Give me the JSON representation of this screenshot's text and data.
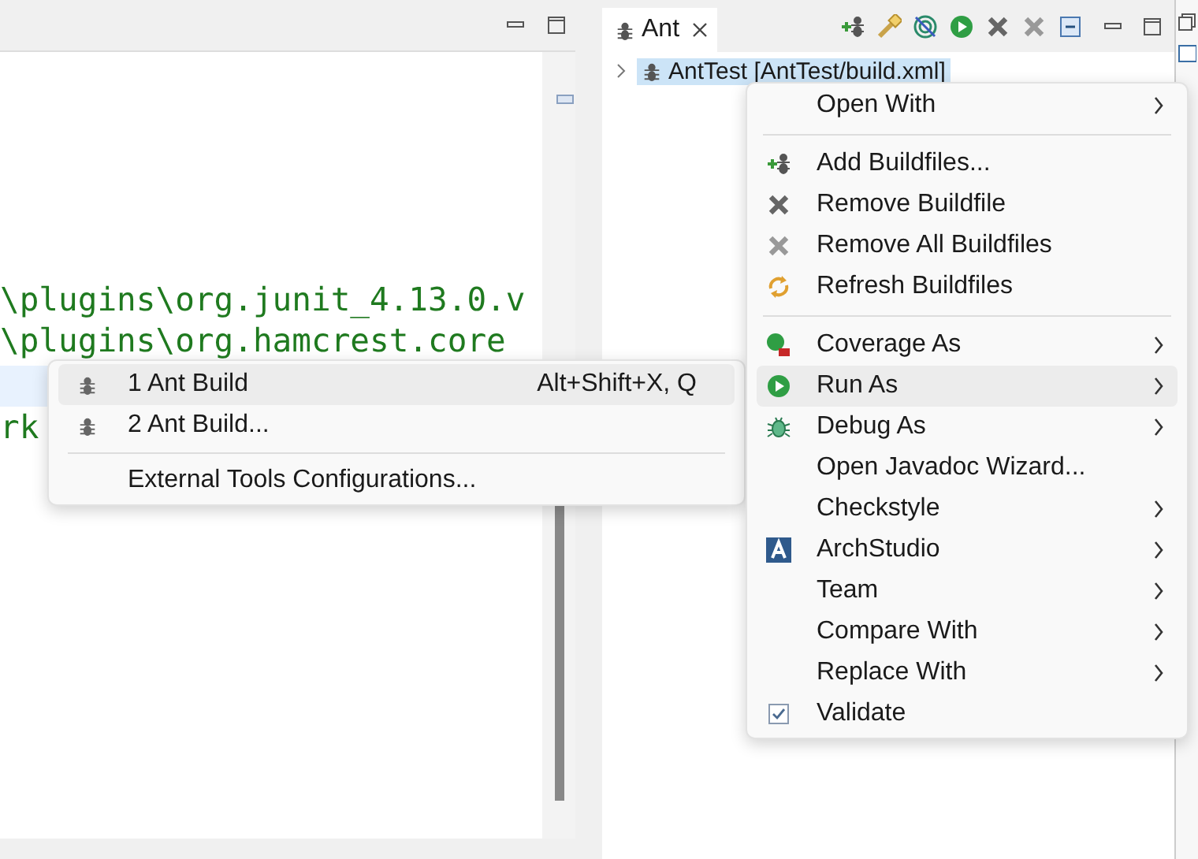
{
  "editor": {
    "code_lines": [
      {
        "text": "\\plugins\\org.junit_4.13.0.v",
        "current": false
      },
      {
        "text": "\\plugins\\org.hamcrest.core",
        "current": false
      },
      {
        "text": "rk",
        "current": false
      }
    ]
  },
  "ant_view": {
    "tab": {
      "label": "Ant",
      "selected": true
    },
    "tree": [
      {
        "label": "AntTest  [AntTest/build.xml]",
        "expanded": false,
        "selected": true
      }
    ]
  },
  "run_as_submenu": {
    "items": [
      {
        "kind": "item",
        "label": "1 Ant Build",
        "shortcut": "Alt+Shift+X, Q",
        "selected": true
      },
      {
        "kind": "item",
        "label": "2 Ant Build...",
        "selected": false
      },
      {
        "kind": "separator"
      },
      {
        "kind": "item",
        "label": "External Tools Configurations...",
        "selected": false
      }
    ]
  },
  "context_menu": {
    "items": [
      {
        "kind": "item",
        "label": "Open With",
        "submenu": true,
        "selected": false
      },
      {
        "kind": "separator"
      },
      {
        "kind": "item",
        "label": "Add Buildfiles...",
        "submenu": false,
        "selected": false
      },
      {
        "kind": "item",
        "label": "Remove Buildfile",
        "submenu": false,
        "selected": false
      },
      {
        "kind": "item",
        "label": "Remove All Buildfiles",
        "submenu": false,
        "selected": false
      },
      {
        "kind": "item",
        "label": "Refresh Buildfiles",
        "submenu": false,
        "selected": false
      },
      {
        "kind": "separator"
      },
      {
        "kind": "item",
        "label": "Coverage As",
        "submenu": true,
        "selected": false
      },
      {
        "kind": "item",
        "label": "Run As",
        "submenu": true,
        "selected": true
      },
      {
        "kind": "item",
        "label": "Debug As",
        "submenu": true,
        "selected": false
      },
      {
        "kind": "item",
        "label": "Open Javadoc Wizard...",
        "submenu": false,
        "selected": false
      },
      {
        "kind": "item",
        "label": "Checkstyle",
        "submenu": true,
        "selected": false
      },
      {
        "kind": "item",
        "label": "ArchStudio",
        "submenu": true,
        "selected": false
      },
      {
        "kind": "item",
        "label": "Team",
        "submenu": true,
        "selected": false
      },
      {
        "kind": "item",
        "label": "Compare With",
        "submenu": true,
        "selected": false
      },
      {
        "kind": "item",
        "label": "Replace With",
        "submenu": true,
        "selected": false
      },
      {
        "kind": "item",
        "label": "Validate",
        "submenu": false,
        "selected": false
      }
    ]
  }
}
